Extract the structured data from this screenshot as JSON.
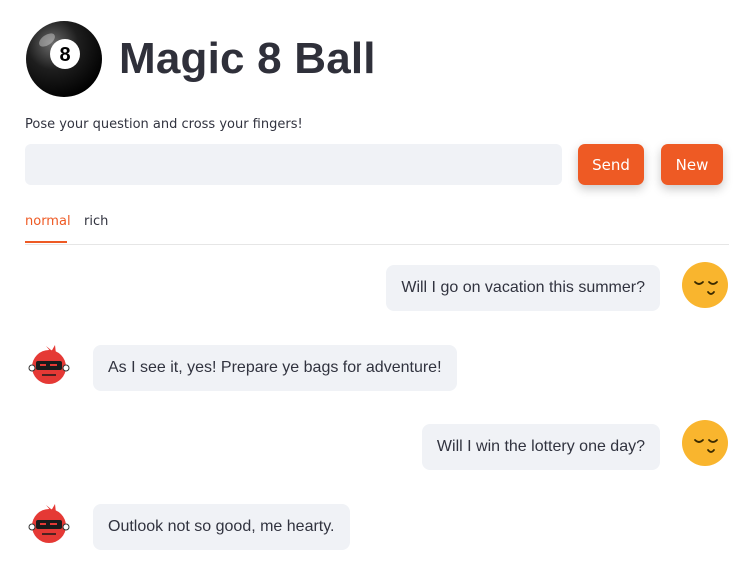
{
  "app": {
    "title": "Magic 8 Ball",
    "logo_number": "8",
    "prompt": "Pose your question and cross your fingers!"
  },
  "input": {
    "value": "",
    "placeholder": ""
  },
  "buttons": {
    "send": "Send",
    "new": "New"
  },
  "tabs": [
    {
      "label": "normal",
      "active": true
    },
    {
      "label": "rich",
      "active": false
    }
  ],
  "messages": [
    {
      "role": "user",
      "text": "Will I go on vacation this summer?",
      "avatar": "smiley-face-icon"
    },
    {
      "role": "bot",
      "text": "As I see it, yes! Prepare ye bags for adventure!",
      "avatar": "pirate-bot-icon"
    },
    {
      "role": "user",
      "text": "Will I win the lottery one day?",
      "avatar": "smiley-face-icon"
    },
    {
      "role": "bot",
      "text": "Outlook not so good, me hearty.",
      "avatar": "pirate-bot-icon"
    }
  ],
  "colors": {
    "accent": "#ee5a24",
    "bubble": "#f0f2f6",
    "user_avatar": "#f9b52e",
    "bot_avatar": "#e53935"
  }
}
